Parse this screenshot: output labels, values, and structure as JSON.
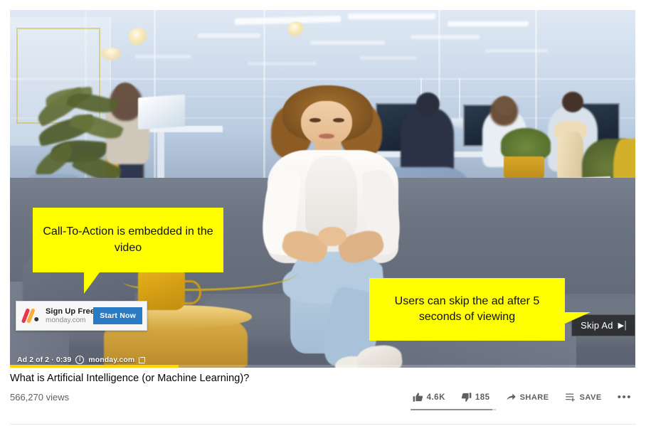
{
  "player": {
    "name": "youtube-video-player",
    "ad": {
      "cta": {
        "logo_icon": "monday-logo-icon",
        "title": "Sign Up Free",
        "subtitle": "monday.com",
        "button_label": "Start Now"
      },
      "info": {
        "counter": "Ad 2 of 2 · 0:39",
        "info_icon": "info-circle-icon",
        "advertiser": "monday.com",
        "external_link_icon": "external-link-icon"
      },
      "skip": {
        "label": "Skip Ad",
        "glyph": "▶|"
      },
      "progress_percent": 27,
      "progress_color": "#ffd600"
    }
  },
  "annotations": [
    {
      "id": "cta-callout",
      "text": "Call-To-Action is embedded in the video",
      "color": "#ffff00",
      "pointer": "down"
    },
    {
      "id": "skip-callout",
      "text": "Users can skip the ad after 5 seconds of viewing",
      "color": "#ffff00",
      "pointer": "right"
    }
  ],
  "meta": {
    "title": "What is Artificial Intelligence (or Machine Learning)?",
    "views": "566,270 views",
    "actions": [
      {
        "name": "like",
        "icon": "thumbs-up-icon",
        "label": "4.6K"
      },
      {
        "name": "dislike",
        "icon": "thumbs-down-icon",
        "label": "185"
      },
      {
        "name": "share",
        "icon": "share-arrow-icon",
        "label": "SHARE"
      },
      {
        "name": "save",
        "icon": "save-list-icon",
        "label": "SAVE"
      },
      {
        "name": "more",
        "icon": "more-dots-icon",
        "label": "•••"
      }
    ]
  }
}
